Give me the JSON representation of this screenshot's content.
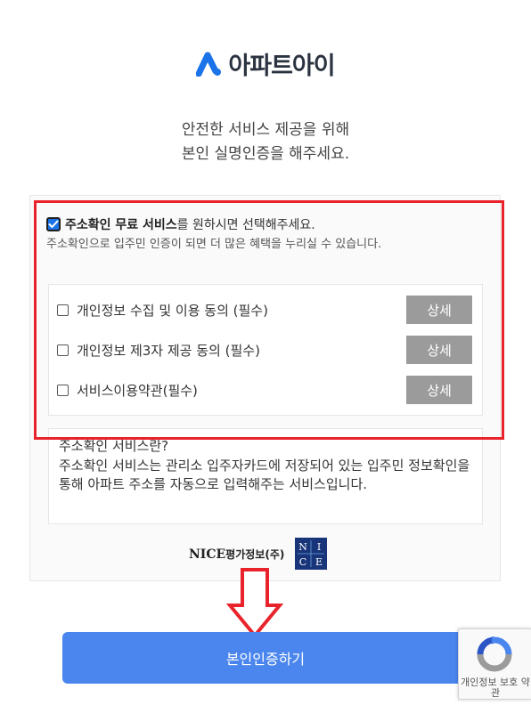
{
  "header": {
    "logo_text": "아파트아이",
    "intro_line1": "안전한 서비스 제공을 위해",
    "intro_line2": "본인 실명인증을 해주세요."
  },
  "consent": {
    "main_bold": "주소확인 무료 서비스",
    "main_rest": "를 원하시면 선택해주세요.",
    "main_checked": true,
    "sub_text": "주소확인으로 입주민 인증이 되면 더 많은 혜택을 누리실 수 있습니다.",
    "terms": [
      {
        "label": "개인정보 수집 및 이용 동의 (필수)",
        "detail": "상세",
        "checked": false
      },
      {
        "label": "개인정보 제3자 제공 동의 (필수)",
        "detail": "상세",
        "checked": false
      },
      {
        "label": "서비스이용약관(필수)",
        "detail": "상세",
        "checked": false
      }
    ]
  },
  "info": {
    "title": "주소확인 서비스란?",
    "body": "주소확인 서비스는 관리소 입주자카드에 저장되어 있는 입주민 정보확인을 통해 아파트 주소를 자동으로 입력해주는 서비스입니다."
  },
  "provider": {
    "name": "NICE",
    "name_kr": "평가정보(주)",
    "logo_letters": [
      "N",
      "I",
      "C",
      "E"
    ]
  },
  "submit": {
    "label": "본인인증하기"
  },
  "recaptcha": {
    "text": "개인정보 보호 약관"
  },
  "colors": {
    "accent": "#4a86ee",
    "highlight": "#e8232b",
    "detail_button": "#9b9b9b",
    "nice_logo": "#18357a",
    "logo_mark": "#1a73e8"
  }
}
